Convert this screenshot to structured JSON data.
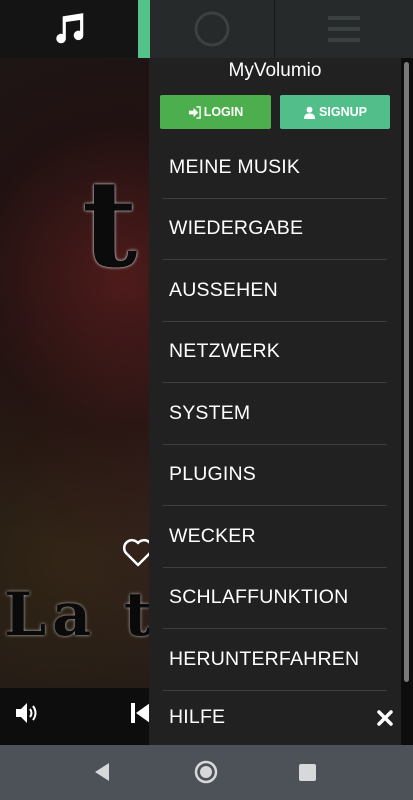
{
  "drawer": {
    "title": "MyVolumio",
    "login_label": "LOGIN",
    "signup_label": "SIGNUP",
    "items": [
      {
        "label": "MEINE MUSIK"
      },
      {
        "label": "WIEDERGABE"
      },
      {
        "label": "AUSSEHEN"
      },
      {
        "label": "NETZWERK"
      },
      {
        "label": "SYSTEM"
      },
      {
        "label": "PLUGINS"
      },
      {
        "label": "WECKER"
      },
      {
        "label": "SCHLAFFUNKTION"
      },
      {
        "label": "HERUNTERFAHREN"
      },
      {
        "label": "HILFE"
      }
    ]
  },
  "tabs": {
    "music_icon": "music-note-icon",
    "playback_icon": "clock-icon",
    "queue_icon": "list-icon"
  },
  "player": {
    "artwork_letter": "t",
    "artwork_bottom_text": "La t"
  },
  "colors": {
    "accent": "#54c38a",
    "login": "#4cae4c",
    "signup": "#52bf8b",
    "drawer_bg": "#212121"
  }
}
